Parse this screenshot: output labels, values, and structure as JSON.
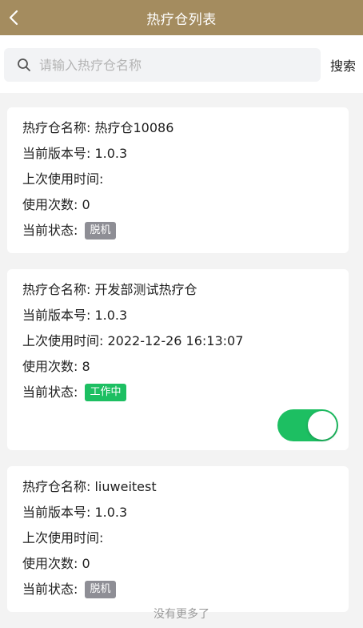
{
  "header": {
    "title": "热疗仓列表"
  },
  "search": {
    "placeholder": "请输入热疗仓名称",
    "button_label": "搜索"
  },
  "cabins": [
    {
      "name": "热疗仓名称: 热疗仓10086",
      "version": "当前版本号: 1.0.3",
      "last_used": "上次使用时间: ",
      "use_count": "使用次数: 0",
      "status_label": "当前状态: ",
      "status": "脱机"
    },
    {
      "name": "热疗仓名称: 开发部测试热疗仓",
      "version": "当前版本号: 1.0.3",
      "last_used": "上次使用时间: 2022-12-26 16:13:07",
      "use_count": "使用次数: 8",
      "status_label": "当前状态: ",
      "status": "工作中",
      "switch_on": true
    },
    {
      "name": "热疗仓名称: liuweitest",
      "version": "当前版本号: 1.0.3",
      "last_used": "上次使用时间: ",
      "use_count": "使用次数: 0",
      "status_label": "当前状态: ",
      "status": "脱机"
    }
  ],
  "footer": {
    "text": "没有更多了"
  },
  "colors": {
    "header_bg": "#a48c5f",
    "offline": "#8e8e95",
    "working": "#1dbf62"
  }
}
